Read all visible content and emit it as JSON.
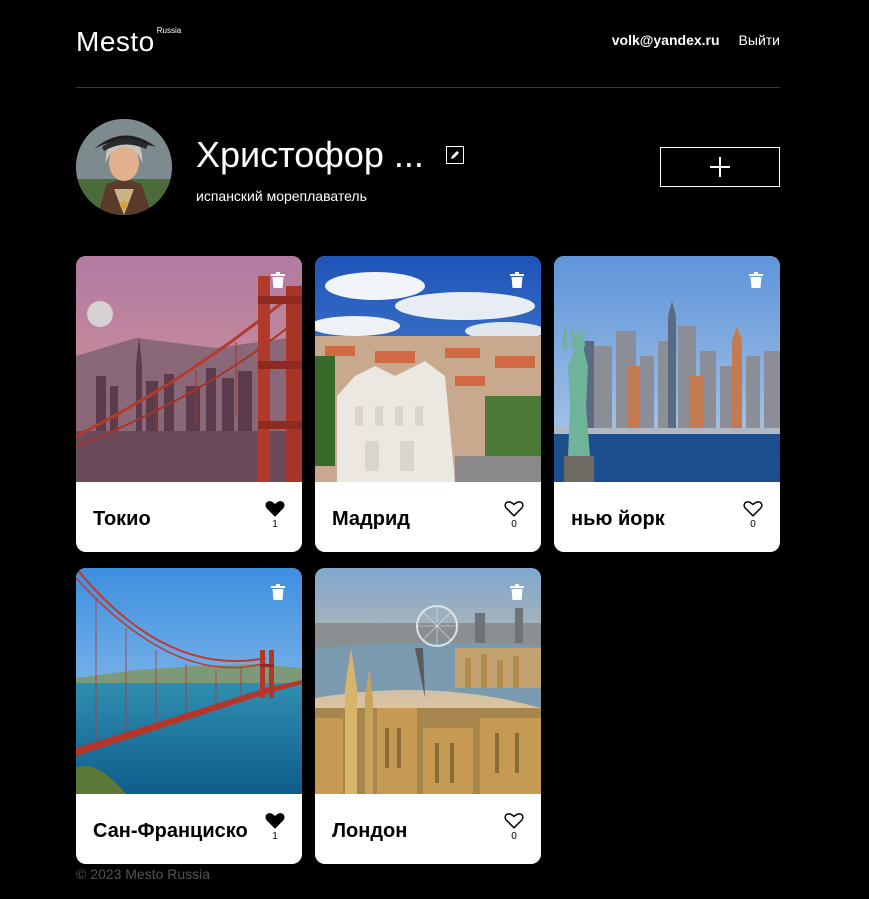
{
  "header": {
    "logo": "Mesto",
    "logo_sub": "Russia",
    "email": "volk@yandex.ru",
    "logout": "Выйти"
  },
  "profile": {
    "name": "Христофор ...",
    "about": "испанский мореплаватель"
  },
  "cards": [
    {
      "title": "Токио",
      "likes": "1",
      "liked": true
    },
    {
      "title": "Мадрид",
      "likes": "0",
      "liked": false
    },
    {
      "title": "нью йорк",
      "likes": "0",
      "liked": false
    },
    {
      "title": "Сан-Франциско",
      "likes": "1",
      "liked": true
    },
    {
      "title": "Лондон",
      "likes": "0",
      "liked": false
    }
  ],
  "footer": {
    "copyright": "© 2023 Mesto Russia"
  },
  "colors": {
    "background": "#000000",
    "card": "#ffffff",
    "footer_text": "#545454"
  }
}
